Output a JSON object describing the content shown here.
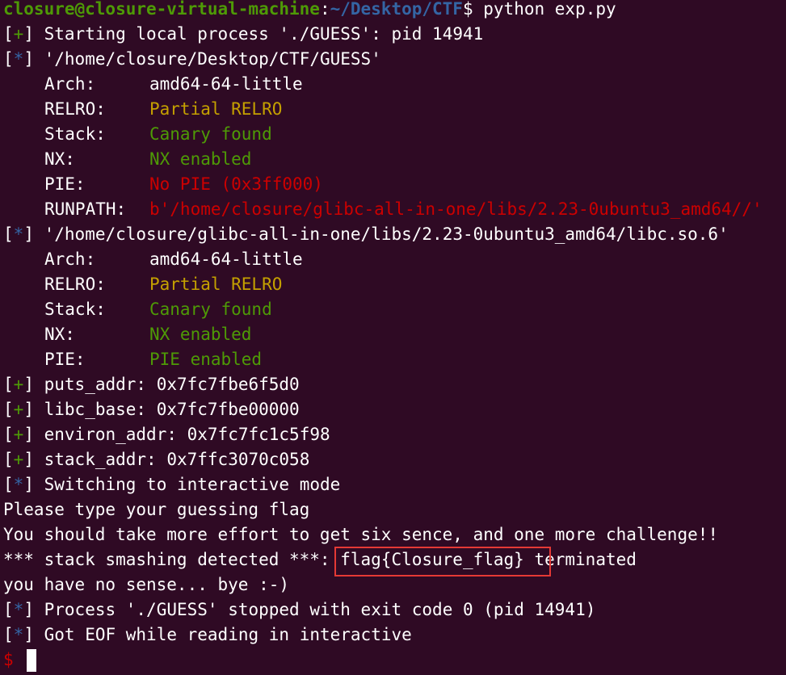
{
  "prompt": {
    "user_host": "closure@closure-virtual-machine",
    "separator": ":",
    "path": "~/Desktop/CTF",
    "symbol": "$",
    "command": " python exp.py"
  },
  "lines": {
    "l1": "Starting local process './GUESS': pid 14941",
    "l2": "'/home/closure/Desktop/CTF/GUESS'",
    "checksec1": {
      "arch_k": "Arch:",
      "arch_v": "amd64-64-little",
      "relro_k": "RELRO:",
      "relro_v": "Partial RELRO",
      "stack_k": "Stack:",
      "stack_v": "Canary found",
      "nx_k": "NX:",
      "nx_v": "NX enabled",
      "pie_k": "PIE:",
      "pie_v": "No PIE (0x3ff000)",
      "runpath_k": "RUNPATH:",
      "runpath_v": "b'/home/closure/glibc-all-in-one/libs/2.23-0ubuntu3_amd64//'"
    },
    "l3": "'/home/closure/glibc-all-in-one/libs/2.23-0ubuntu3_amd64/libc.so.6'",
    "checksec2": {
      "arch_k": "Arch:",
      "arch_v": "amd64-64-little",
      "relro_k": "RELRO:",
      "relro_v": "Partial RELRO",
      "stack_k": "Stack:",
      "stack_v": "Canary found",
      "nx_k": "NX:",
      "nx_v": "NX enabled",
      "pie_k": "PIE:",
      "pie_v": "PIE enabled"
    },
    "puts": "puts_addr: 0x7fc7fbe6f5d0",
    "libc": "libc_base: 0x7fc7fbe00000",
    "environ": "environ_addr: 0x7fc7fc1c5f98",
    "stack": "stack_addr: 0x7ffc3070c058",
    "interactive": "Switching to interactive mode",
    "please": "Please type your guessing flag",
    "effort": "You should take more effort to get six sence, and one more challenge!!",
    "smash_pre": "*** stack smashing detected ***: ",
    "smash_flag": "flag{Closure_flag}",
    "smash_post": " terminated",
    "nosense": "you have no sense... bye :-)",
    "stopped": "Process './GUESS' stopped with exit code 0 (pid 14941)",
    "eof": "Got EOF while reading in interactive",
    "final_prompt": "$"
  },
  "markers": {
    "plus": "+",
    "star": "*",
    "open": "[",
    "close": "]"
  },
  "colors": {
    "background": "#2f0a24",
    "green": "#4e9a06",
    "blue": "#3465a4",
    "yellow": "#c4a000",
    "red": "#cc0000",
    "highlight_border": "#e53935"
  }
}
